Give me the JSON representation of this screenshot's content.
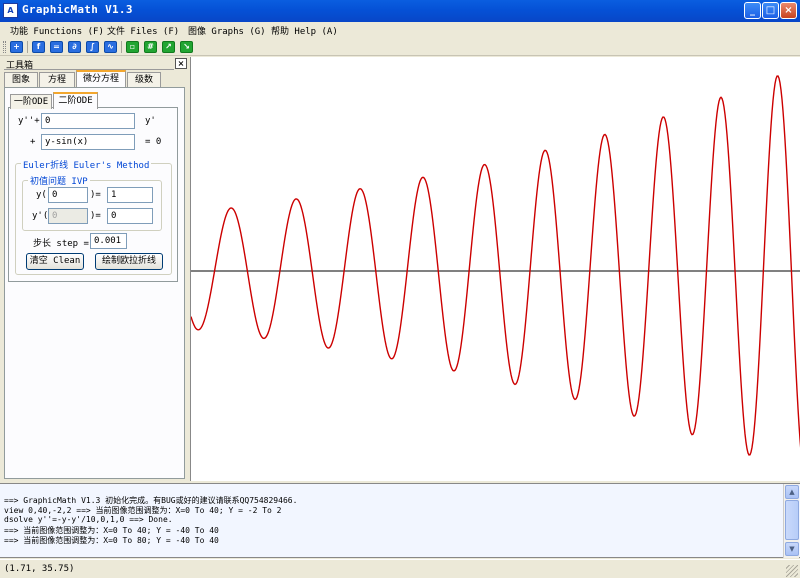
{
  "window": {
    "title": "GraphicMath V1.3",
    "icon_text": "A",
    "controls": [
      "_",
      "□",
      "×"
    ]
  },
  "menu": [
    {
      "label": "功能 Functions (F)"
    },
    {
      "label": "文件 Files (F)"
    },
    {
      "label": "图像 Graphs (G)"
    },
    {
      "label": "帮助 Help (A)"
    }
  ],
  "toolbar": {
    "icons": [
      "add-icon",
      "function-icon",
      "equation-icon",
      "derivative-icon",
      "integral-icon",
      "graph-icon",
      "zoom-in-icon",
      "grid-icon",
      "fit-icon",
      "move-icon"
    ]
  },
  "toolbox": {
    "title": "工具箱",
    "close": "×",
    "tabs": [
      "图象",
      "方程",
      "微分方程",
      "级数"
    ],
    "active_tab": "微分方程",
    "subtabs": [
      "一阶ODE",
      "二阶ODE"
    ],
    "active_subtab": "二阶ODE",
    "ode": {
      "y2_label": "y''+",
      "coef1_value": "0",
      "y1_suffix": "y'",
      "plus": "+",
      "rhs_value": "y-sin(x)",
      "equals_zero": "= 0"
    },
    "euler": {
      "legend": "Euler折线 Euler's Method",
      "ivp_legend": "初值问题 IVP",
      "y_label": "y(",
      "y_x0": "0",
      "y_eq": ")=",
      "y_value": "1",
      "yp_label": "y'(",
      "yp_x0": "0",
      "yp_eq": ")=",
      "yp_value": "0",
      "step_label": "步长 step =",
      "step_value": "0.001",
      "clear_button": "清空 Clean",
      "draw_button": "绘制欧拉折线"
    }
  },
  "graph": {
    "curve_color": "#cc0000",
    "axis_color": "#000000"
  },
  "console": {
    "lines": [
      "==> GraphicMath V1.3 初始化完成。有BUG或好的建议请联系QQ754829466.",
      "view 0,40,-2,2 ==> 当前图像范围调整为：X=0 To 40; Y = -2 To 2",
      "dsolve y''=-y-y'/10,0,1,0 ==> Done.",
      " ==> 当前图像范围调整为：X=0 To 40; Y = -40 To 40",
      " ==> 当前图像范围调整为：X=0 To 80; Y = -40 To 40"
    ]
  },
  "status": {
    "coordinates": "(1.71, 35.75)"
  }
}
